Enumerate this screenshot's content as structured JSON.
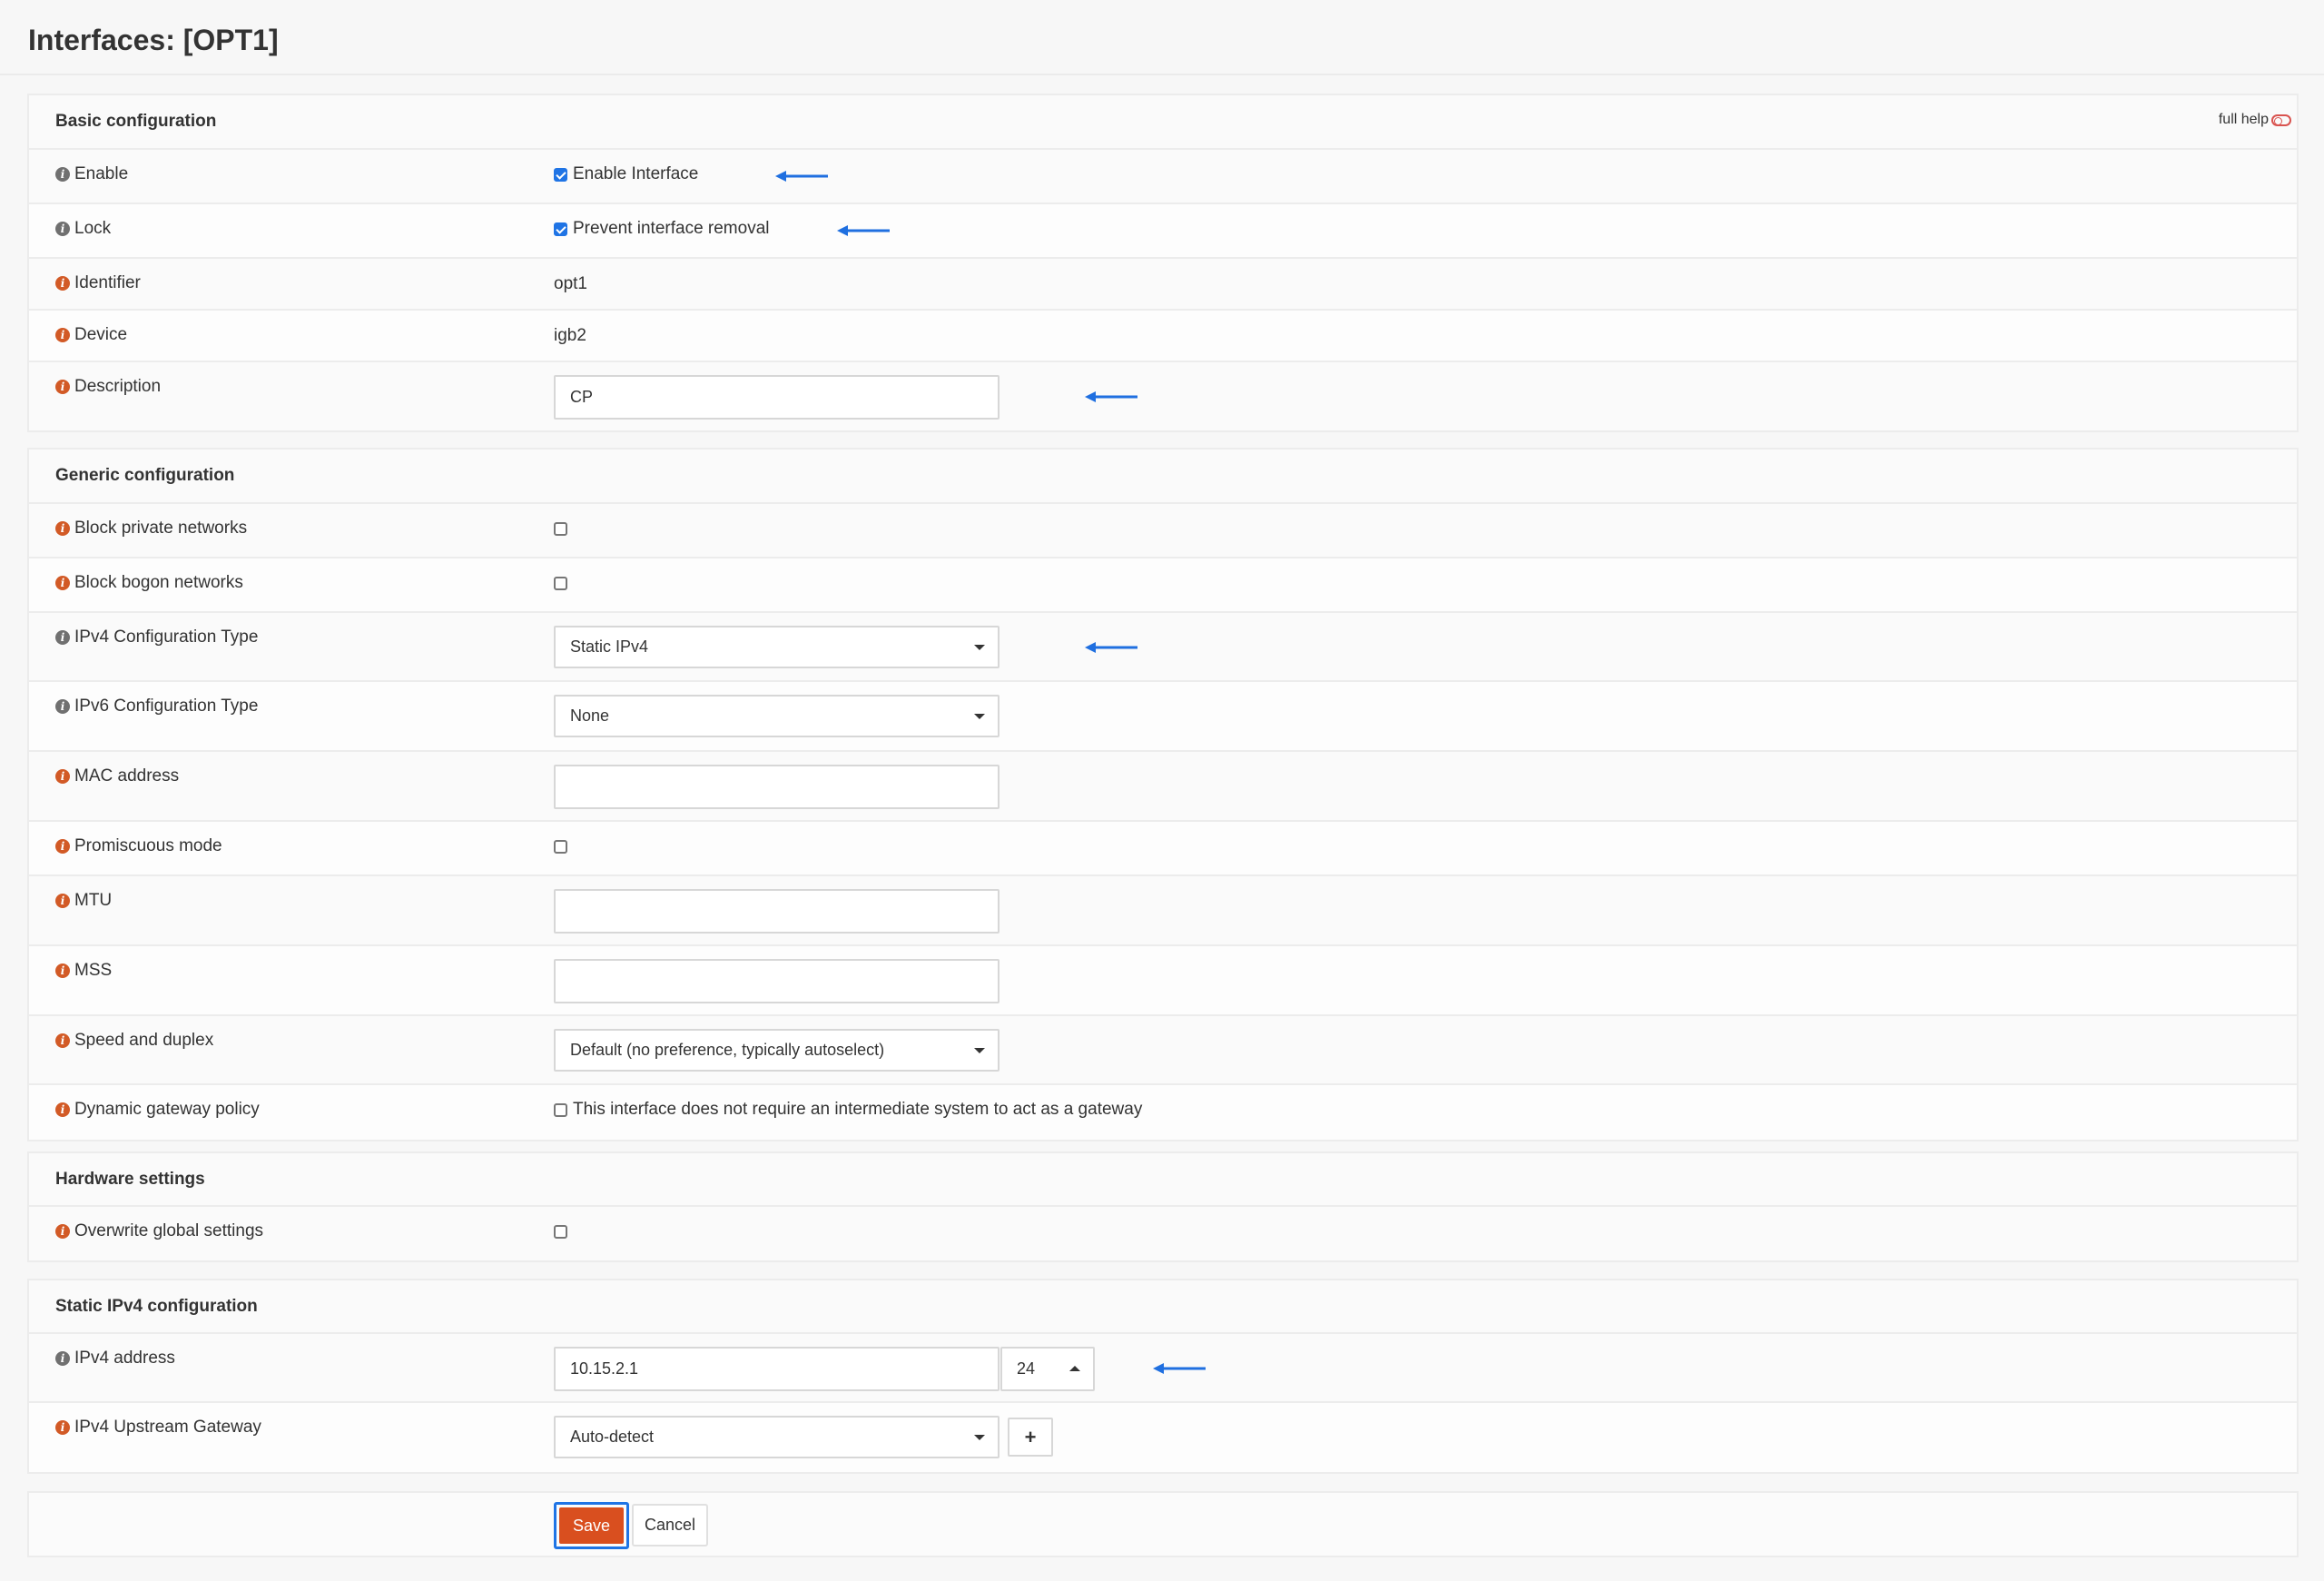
{
  "page": {
    "title": "Interfaces: [OPT1]"
  },
  "full_help": {
    "label": "full help",
    "icon": "toggle-off-icon"
  },
  "sections": {
    "basic": {
      "title": "Basic configuration",
      "enable": {
        "label": "Enable",
        "checkbox_label": "Enable Interface",
        "checked": true
      },
      "lock": {
        "label": "Lock",
        "checkbox_label": "Prevent interface removal",
        "checked": true
      },
      "identifier": {
        "label": "Identifier",
        "value": "opt1"
      },
      "device": {
        "label": "Device",
        "value": "igb2"
      },
      "description": {
        "label": "Description",
        "value": "CP"
      }
    },
    "generic": {
      "title": "Generic configuration",
      "block_private": {
        "label": "Block private networks",
        "checked": false
      },
      "block_bogon": {
        "label": "Block bogon networks",
        "checked": false
      },
      "ipv4_type": {
        "label": "IPv4 Configuration Type",
        "value": "Static IPv4"
      },
      "ipv6_type": {
        "label": "IPv6 Configuration Type",
        "value": "None"
      },
      "mac": {
        "label": "MAC address",
        "value": ""
      },
      "promiscuous": {
        "label": "Promiscuous mode",
        "checked": false
      },
      "mtu": {
        "label": "MTU",
        "value": ""
      },
      "mss": {
        "label": "MSS",
        "value": ""
      },
      "speed": {
        "label": "Speed and duplex",
        "value": "Default (no preference, typically autoselect)"
      },
      "dyn_gw": {
        "label": "Dynamic gateway policy",
        "checkbox_label": "This interface does not require an intermediate system to act as a gateway",
        "checked": false
      }
    },
    "hardware": {
      "title": "Hardware settings",
      "overwrite": {
        "label": "Overwrite global settings",
        "checked": false
      }
    },
    "static_ipv4": {
      "title": "Static IPv4 configuration",
      "address": {
        "label": "IPv4 address",
        "value": "10.15.2.1",
        "subnet": "24"
      },
      "gateway": {
        "label": "IPv4 Upstream Gateway",
        "value": "Auto-detect",
        "add_label": "+"
      }
    }
  },
  "actions": {
    "save": "Save",
    "cancel": "Cancel"
  },
  "colors": {
    "accent": "#d94f1f",
    "focus": "#1f74e5",
    "annotation_arrow": "#1f6fe0"
  }
}
